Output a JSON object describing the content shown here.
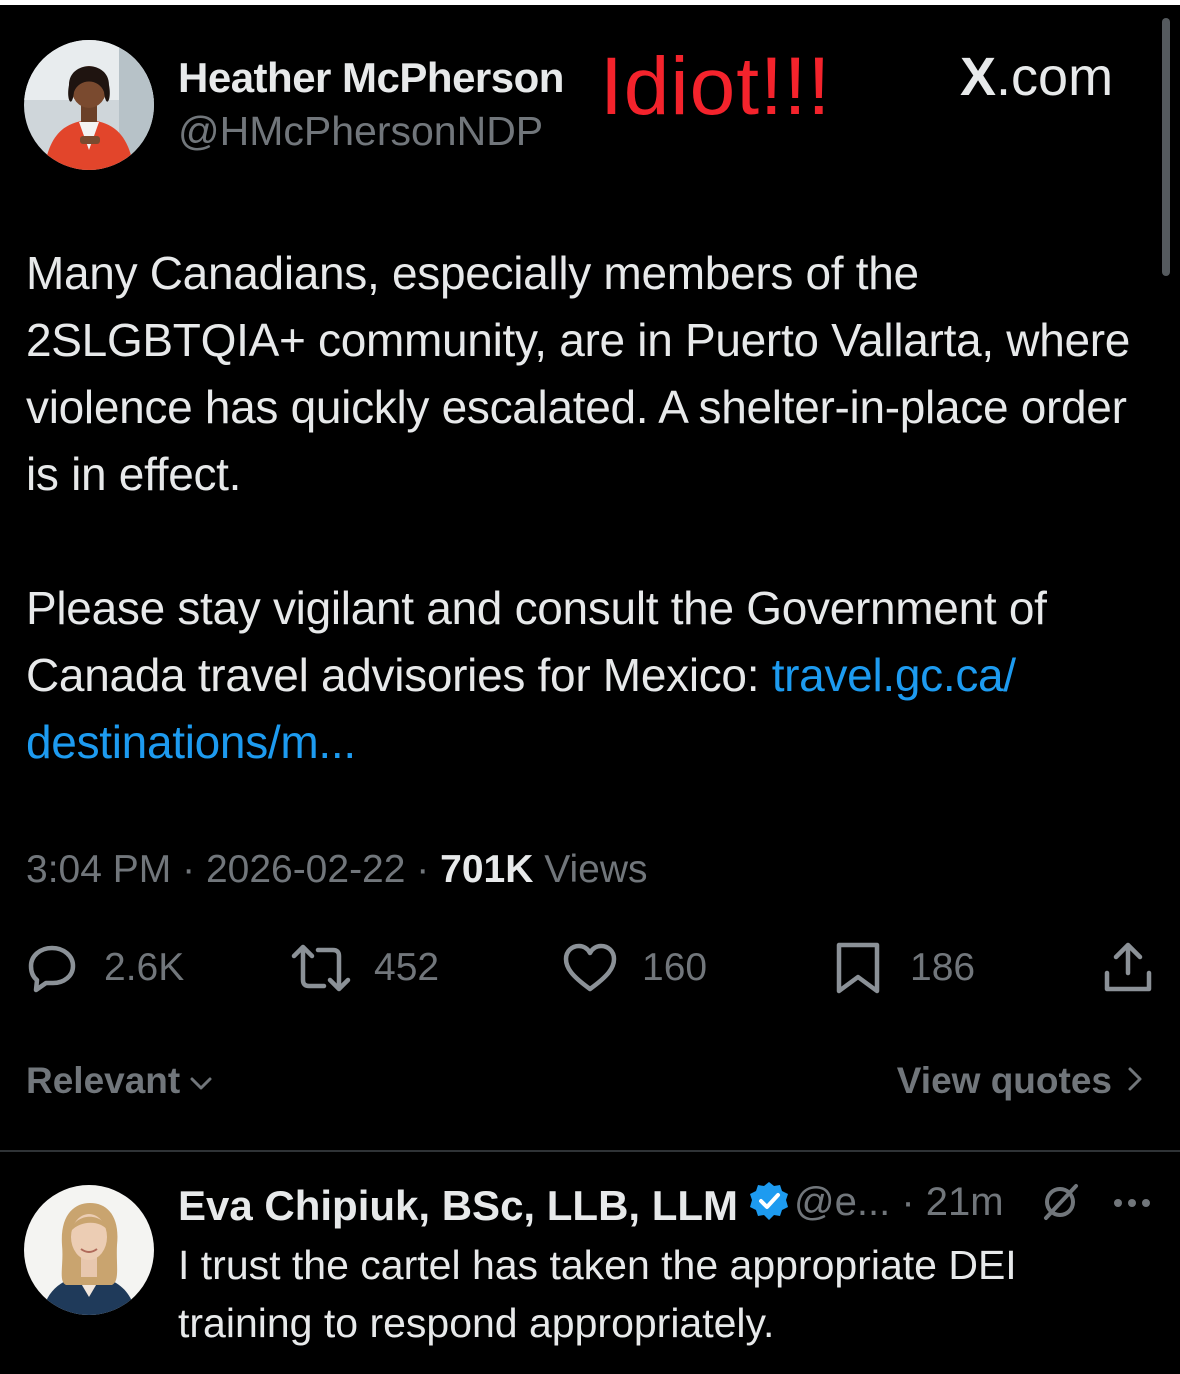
{
  "post": {
    "author_name": "Heather McPherson",
    "author_handle": "@HMcPhersonNDP",
    "overlay_text": "Idiot!!!",
    "source_logo": "X",
    "source_domain": ".com",
    "text_p1": "Many Canadians, especially members of the 2SLGBTQIA+ community, are in Puerto Vallarta, where violence has quickly escalated. A shelter-in-place order is in effect.",
    "text_p2": "Please stay vigilant and consult the Government of Canada travel advisories for Mexico: ",
    "link_text": "travel.gc.ca/ destinations/m...",
    "time": "3:04 PM",
    "sep": "·",
    "date": "2026-02-22",
    "views_count": "701K",
    "views_label": "Views"
  },
  "actions": {
    "replies": "2.6K",
    "reposts": "452",
    "likes": "160",
    "bookmarks": "186"
  },
  "replies_bar": {
    "sort_label": "Relevant",
    "quotes_label": "View quotes"
  },
  "reply": {
    "author_name": "Eva Chipiuk, BSc, LLB, LLM",
    "handle": "@e...",
    "sep": "·",
    "time": "21m",
    "text": "I trust the cartel has taken the appropriate DEI training to respond appropriately."
  },
  "colors": {
    "background": "#000000",
    "text": "#e7e9ea",
    "muted": "#71767b",
    "link": "#1d9bf0",
    "overlay": "#f4232c",
    "verified": "#1d9bf0"
  },
  "icons": [
    "reply-icon",
    "repost-icon",
    "like-icon",
    "bookmark-icon",
    "share-icon",
    "chevron-down-icon",
    "chevron-right-icon",
    "verified-badge-icon",
    "grok-icon",
    "more-icon"
  ]
}
